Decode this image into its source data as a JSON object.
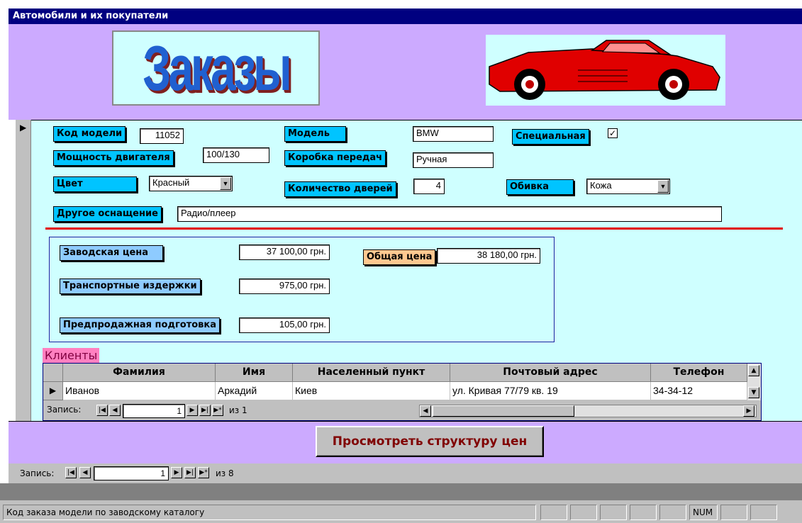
{
  "window": {
    "title": "Автомобили и их покупатели"
  },
  "header": {
    "logo_text": "Заказы"
  },
  "fields": {
    "model_code": {
      "label": "Код модели",
      "value": "11052"
    },
    "engine_power": {
      "label": "Мощность двигателя",
      "value": "100/130"
    },
    "color": {
      "label": "Цвет",
      "value": "Красный"
    },
    "model": {
      "label": "Модель",
      "value": "BMW"
    },
    "gearbox": {
      "label": "Коробка передач",
      "value": "Ручная"
    },
    "doors": {
      "label": "Количество дверей",
      "value": "4"
    },
    "special": {
      "label": "Специальная",
      "checked": "✓"
    },
    "upholstery": {
      "label": "Обивка",
      "value": "Кожа"
    },
    "other_equipment": {
      "label": "Другое оснащение",
      "value": "Радио/плеер"
    }
  },
  "prices": {
    "factory": {
      "label": "Заводская цена",
      "value": "37 100,00 грн."
    },
    "transport": {
      "label": "Транспортные издержки",
      "value": "975,00 грн."
    },
    "presale": {
      "label": "Предпродажная подготовка",
      "value": "105,00 грн."
    },
    "total": {
      "label": "Общая цена",
      "value": "38 180,00 грн."
    }
  },
  "clients": {
    "title": "Клиенты",
    "columns": [
      "Фамилия",
      "Имя",
      "Населенный пункт",
      "Почтовый адрес",
      "Телефон"
    ],
    "rows": [
      [
        "Иванов",
        "Аркадий",
        "Киев",
        "ул. Кривая 77/79 кв. 19",
        "34-34-12"
      ]
    ],
    "nav": {
      "label": "Запись:",
      "current": "1",
      "of_text": "из 1"
    }
  },
  "actions": {
    "view_price_structure": "Просмотреть структуру цен"
  },
  "main_nav": {
    "label": "Запись:",
    "current": "1",
    "of_text": "из 8"
  },
  "statusbar": {
    "message": "Код заказа модели по заводскому каталогу",
    "num": "NUM"
  },
  "colors": {
    "titlebar": "#000080",
    "header_bg": "#ccaaff",
    "form_bg": "#cfffff",
    "label_bg": "#00c4ff",
    "separator": "#e00000"
  }
}
